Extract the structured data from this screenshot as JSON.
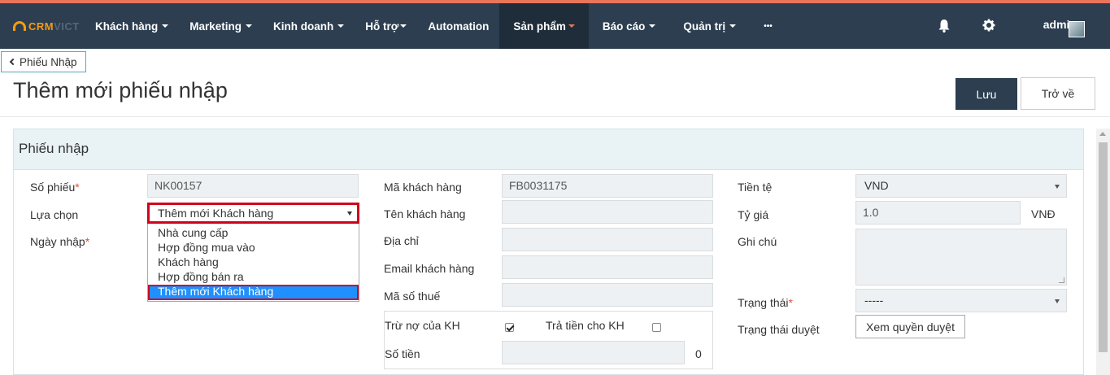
{
  "app": {
    "logo_primary": "CRM",
    "logo_secondary": "VICT",
    "accent_color": "#e8765a",
    "nav_bg": "#2c3e50"
  },
  "nav": {
    "items": [
      {
        "label": "Khách hàng",
        "has_caret": true
      },
      {
        "label": "Marketing",
        "has_caret": true
      },
      {
        "label": "Kinh doanh",
        "has_caret": true
      },
      {
        "label": "Hỗ trợ",
        "has_caret": true
      },
      {
        "label": "Automation",
        "has_caret": false
      },
      {
        "label": "Sản phẩm",
        "has_caret": true,
        "active": true
      },
      {
        "label": "Báo cáo",
        "has_caret": true
      },
      {
        "label": "Quản trị",
        "has_caret": true
      },
      {
        "label": "•••",
        "has_caret": false
      }
    ],
    "user": "admin",
    "icons": [
      "bell-icon",
      "gear-icon"
    ]
  },
  "header": {
    "back_label": "Phiếu Nhập",
    "title": "Thêm mới phiếu nhập",
    "save_label": "Lưu",
    "return_label": "Trở về"
  },
  "panel": {
    "title": "Phiếu nhập"
  },
  "form": {
    "so_phieu_label": "Số phiếu",
    "so_phieu_value": "NK00157",
    "lua_chon_label": "Lựa chọn",
    "lua_chon_value": "Thêm mới Khách hàng",
    "lua_chon_options": [
      "Nhà cung cấp",
      "Hợp đồng mua vào",
      "Khách hàng",
      "Hợp đồng bán ra",
      "Thêm mới Khách hàng"
    ],
    "ngay_nhap_label": "Ngày nhập",
    "ma_kh_label": "Mã khách hàng",
    "ma_kh_value": "FB0031175",
    "ten_kh_label": "Tên khách hàng",
    "dia_chi_label": "Địa chỉ",
    "email_label": "Email khách hàng",
    "mst_label": "Mã số thuế",
    "tru_no_label": "Trừ nợ của KH",
    "tru_no_checked": true,
    "tra_tien_label": "Trả tiền cho KH",
    "tra_tien_checked": false,
    "so_tien_label": "Số tiền",
    "so_tien_value": "0",
    "tien_te_label": "Tiền tệ",
    "tien_te_value": "VND",
    "ty_gia_label": "Tỷ giá",
    "ty_gia_value": "1.0",
    "ty_gia_unit": "VNĐ",
    "ghi_chu_label": "Ghi chú",
    "trang_thai_label": "Trạng thái",
    "trang_thai_value": "-----",
    "trang_thai_duyet_label": "Trạng thái duyệt",
    "xem_quyen_duyet_label": "Xem quyền duyệt"
  }
}
